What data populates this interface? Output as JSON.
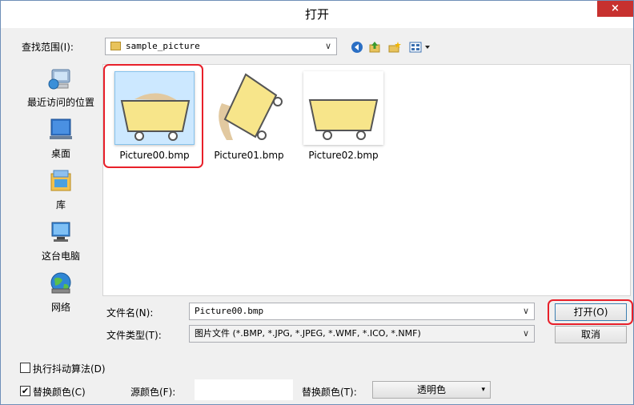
{
  "window": {
    "title": "打开",
    "close_glyph": "×"
  },
  "lookin": {
    "label": "查找范围(I):",
    "value": "sample_picture",
    "arrow": "∨"
  },
  "places": [
    {
      "label": "最近访问的位置",
      "icon": "recent-places-icon"
    },
    {
      "label": "桌面",
      "icon": "desktop-icon"
    },
    {
      "label": "库",
      "icon": "libraries-icon"
    },
    {
      "label": "这台电脑",
      "icon": "this-pc-icon"
    },
    {
      "label": "网络",
      "icon": "network-icon"
    }
  ],
  "files": [
    {
      "name": "Picture00.bmp",
      "selected": true
    },
    {
      "name": "Picture01.bmp",
      "selected": false
    },
    {
      "name": "Picture02.bmp",
      "selected": false
    }
  ],
  "filename": {
    "label": "文件名(N):",
    "value": "Picture00.bmp",
    "arrow": "∨"
  },
  "filetype": {
    "label": "文件类型(T):",
    "value": "图片文件 (*.BMP, *.JPG, *.JPEG, *.WMF, *.ICO, *.NMF)",
    "arrow": "∨"
  },
  "buttons": {
    "open": "打开(O)",
    "cancel": "取消"
  },
  "options": {
    "dither": {
      "label": "执行抖动算法(D)",
      "checked": false,
      "mark": ""
    },
    "replace": {
      "label": "替换颜色(C)",
      "checked": true,
      "mark": "✔"
    },
    "source_color_label": "源颜色(F):",
    "replace_color_label": "替换颜色(T):",
    "replace_color_value": "透明色",
    "caret": "▾"
  },
  "colors": {
    "highlight": "#e8202a",
    "close": "#c7312f",
    "cart_fill": "#f7e58a"
  }
}
